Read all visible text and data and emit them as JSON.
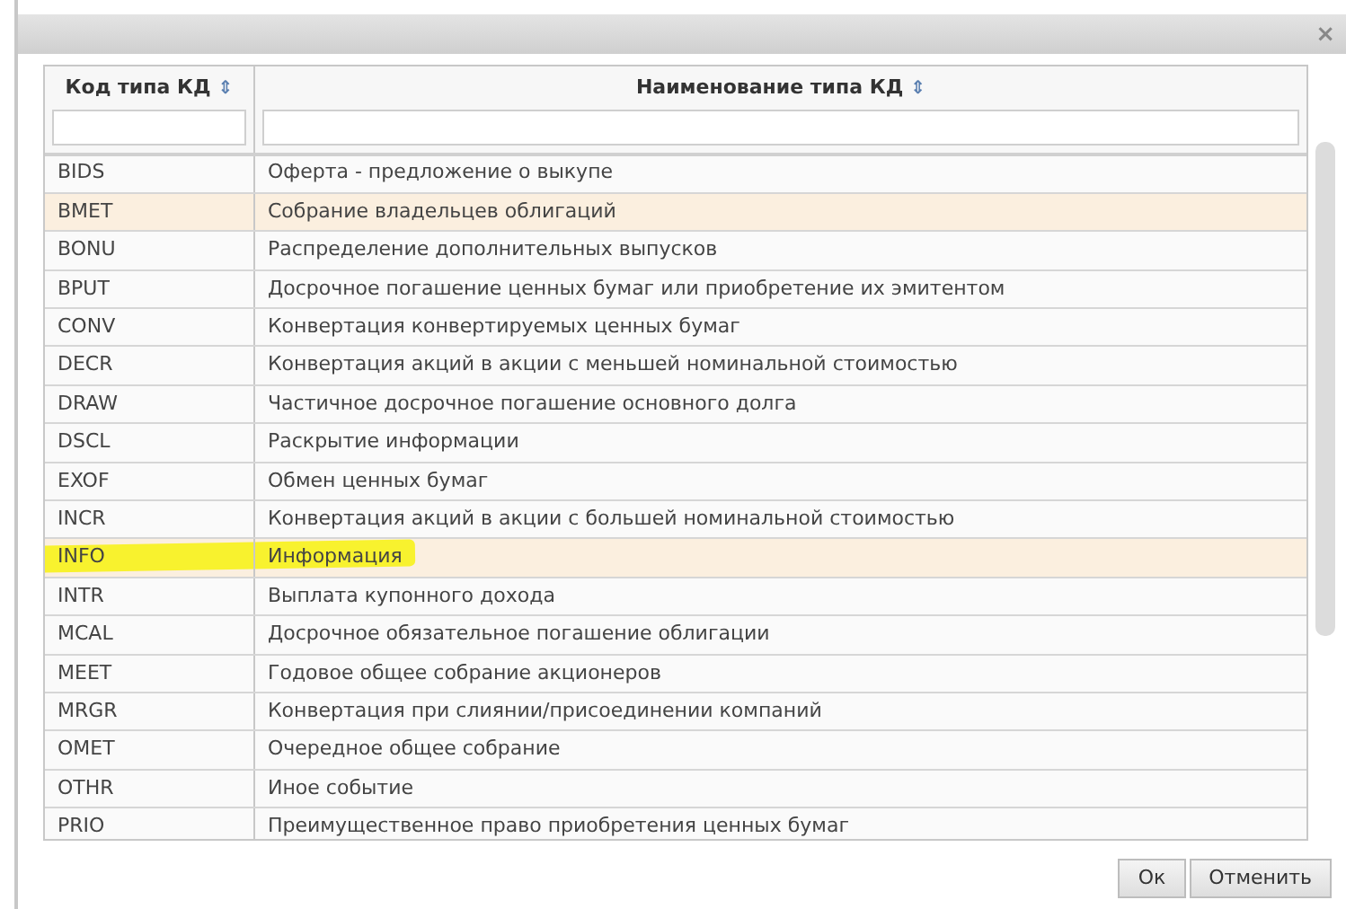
{
  "dialog": {
    "close": "×"
  },
  "table": {
    "columns": [
      {
        "label": "Код типа КД",
        "sort": "⇕"
      },
      {
        "label": "Наименование типа КД",
        "sort": "⇕"
      }
    ],
    "rows": [
      {
        "code": "BIDS",
        "name": "Оферта - предложение о выкупе",
        "selected": false,
        "marked": false
      },
      {
        "code": "BMET",
        "name": "Собрание владельцев облигаций",
        "selected": true,
        "marked": false
      },
      {
        "code": "BONU",
        "name": "Распределение дополнительных выпусков",
        "selected": false,
        "marked": false
      },
      {
        "code": "BPUT",
        "name": "Досрочное погашение ценных бумаг или приобретение их эмитентом",
        "selected": false,
        "marked": false
      },
      {
        "code": "CONV",
        "name": "Конвертация конвертируемых ценных бумаг",
        "selected": false,
        "marked": false
      },
      {
        "code": "DECR",
        "name": "Конвертация акций в акции с меньшей номинальной стоимостью",
        "selected": false,
        "marked": false
      },
      {
        "code": "DRAW",
        "name": "Частичное досрочное погашение основного долга",
        "selected": false,
        "marked": false
      },
      {
        "code": "DSCL",
        "name": "Раскрытие информации",
        "selected": false,
        "marked": false
      },
      {
        "code": "EXOF",
        "name": "Обмен ценных бумаг",
        "selected": false,
        "marked": false
      },
      {
        "code": "INCR",
        "name": "Конвертация акций в акции с большей номинальной стоимостью",
        "selected": false,
        "marked": false
      },
      {
        "code": "INFO",
        "name": "Информация",
        "selected": true,
        "marked": true
      },
      {
        "code": "INTR",
        "name": "Выплата купонного дохода",
        "selected": false,
        "marked": false
      },
      {
        "code": "MCAL",
        "name": "Досрочное обязательное погашение облигации",
        "selected": false,
        "marked": false
      },
      {
        "code": "MEET",
        "name": "Годовое общее собрание акционеров",
        "selected": false,
        "marked": false
      },
      {
        "code": "MRGR",
        "name": "Конвертация при слиянии/присоединении компаний",
        "selected": false,
        "marked": false
      },
      {
        "code": "OMET",
        "name": "Очередное общее собрание",
        "selected": false,
        "marked": false
      },
      {
        "code": "OTHR",
        "name": "Иное событие",
        "selected": false,
        "marked": false
      },
      {
        "code": "PRIO",
        "name": "Преимущественное право приобретения ценных бумаг",
        "selected": false,
        "marked": false
      }
    ]
  },
  "buttons": [
    {
      "label": "Ок"
    },
    {
      "label": "Отменить"
    }
  ]
}
